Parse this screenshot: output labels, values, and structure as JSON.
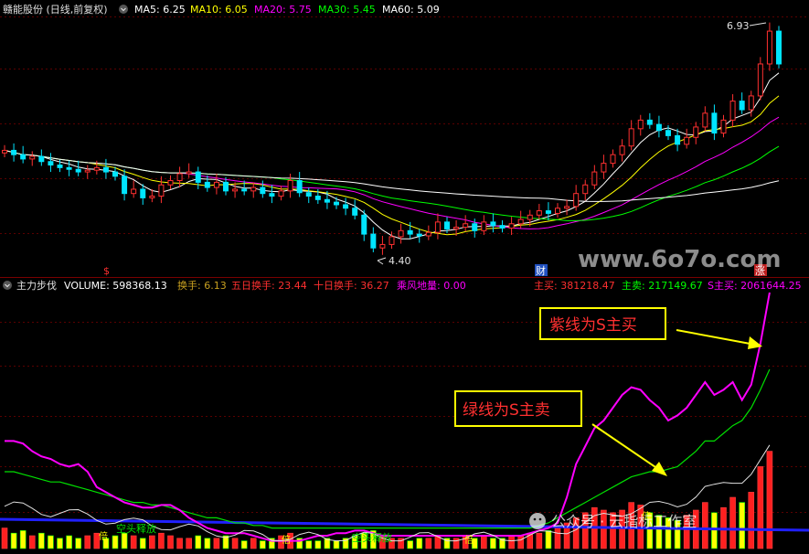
{
  "header": {
    "stock_title": "赣能股份 (日线,前复权)",
    "dropdown_icon": "chevron-down-icon",
    "ma_indicators": [
      {
        "label": "MA5: 6.25",
        "color": "#ffffff"
      },
      {
        "label": "MA10: 6.05",
        "color": "#ffff00"
      },
      {
        "label": "MA20: 5.75",
        "color": "#ff00ff"
      },
      {
        "label": "MA30: 5.45",
        "color": "#00ff00"
      },
      {
        "label": "MA60: 5.09",
        "color": "#ffffff"
      }
    ]
  },
  "price_panel": {
    "high_label": "6.93",
    "low_label": "4.40",
    "event_markers": [
      "$",
      "财",
      "涨"
    ],
    "watermark": "www.6o7o.com"
  },
  "volume_panel": {
    "indicator_name": "主力步伐",
    "stats": [
      {
        "label": "VOLUME: 598368.13",
        "color": "#ffffff"
      },
      {
        "label": "换手: 6.13",
        "color": "#c8a020"
      },
      {
        "label": "五日换手: 23.44",
        "color": "#ff3030"
      },
      {
        "label": "十日换手: 36.27",
        "color": "#ff3030"
      },
      {
        "label": "乘风地量: 0.00",
        "color": "#ff00ff"
      },
      {
        "label": "主买: 381218.47",
        "color": "#ff3030"
      },
      {
        "label": "主卖: 217149.67",
        "color": "#00ff00"
      },
      {
        "label": "S主买: 2061644.25",
        "color": "#ff00ff"
      }
    ],
    "annotations": {
      "purple_note": "紫线为S主买",
      "green_note": "绿线为S主卖"
    },
    "bottom_labels": {
      "release_1": "空头释放",
      "release_2": "空头释放",
      "bei": "倍"
    },
    "wechat_watermark": "公众号 · 云指标工作室"
  },
  "chart_data": [
    {
      "type": "candlestick",
      "title": "赣能股份 (日线,前复权)",
      "series": [
        {
          "name": "MA5",
          "color": "#ffffff",
          "last_value": 6.25
        },
        {
          "name": "MA10",
          "color": "#ffff00",
          "last_value": 6.05
        },
        {
          "name": "MA20",
          "color": "#ff00ff",
          "last_value": 5.75
        },
        {
          "name": "MA30",
          "color": "#00ff00",
          "last_value": 5.45
        },
        {
          "name": "MA60",
          "color": "#ffffff",
          "last_value": 5.09
        }
      ],
      "closes": [
        5.55,
        5.5,
        5.45,
        5.48,
        5.42,
        5.38,
        5.35,
        5.33,
        5.3,
        5.32,
        5.35,
        5.3,
        5.25,
        5.05,
        5.1,
        5.0,
        5.02,
        5.15,
        5.2,
        5.28,
        5.3,
        5.18,
        5.12,
        5.18,
        5.08,
        5.1,
        5.08,
        5.12,
        5.05,
        5.02,
        5.08,
        5.2,
        5.06,
        5.02,
        4.98,
        4.95,
        4.92,
        4.88,
        4.8,
        4.58,
        4.42,
        4.46,
        4.55,
        4.62,
        4.58,
        4.56,
        4.6,
        4.72,
        4.64,
        4.66,
        4.7,
        4.62,
        4.72,
        4.68,
        4.65,
        4.7,
        4.75,
        4.8,
        4.85,
        4.82,
        4.88,
        4.9,
        5.05,
        5.15,
        5.3,
        5.4,
        5.5,
        5.6,
        5.8,
        5.9,
        5.85,
        5.78,
        5.72,
        5.62,
        5.7,
        5.82,
        5.98,
        5.75,
        5.9,
        6.12,
        6.02,
        6.18,
        6.55,
        6.93,
        6.55
      ],
      "high_marker": 6.93,
      "low_marker": 4.4
    },
    {
      "type": "bar+line",
      "name": "主力步伐",
      "stats": {
        "VOLUME": 598368.13,
        "换手": 6.13,
        "五日换手": 23.44,
        "十日换手": 36.27,
        "乘风地量": 0.0,
        "主买": 381218.47,
        "主卖": 217149.67,
        "S主买": 2061644.25
      },
      "s_buy_line": [
        0.42,
        0.42,
        0.41,
        0.38,
        0.36,
        0.35,
        0.33,
        0.32,
        0.33,
        0.3,
        0.24,
        0.22,
        0.2,
        0.18,
        0.17,
        0.16,
        0.16,
        0.17,
        0.17,
        0.15,
        0.12,
        0.1,
        0.08,
        0.07,
        0.06,
        0.06,
        0.06,
        0.05,
        0.04,
        0.03,
        0.03,
        0.03,
        0.03,
        0.04,
        0.05,
        0.05,
        0.06,
        0.06,
        0.07,
        0.07,
        0.06,
        0.05,
        0.05,
        0.05,
        0.05,
        0.05,
        0.05,
        0.05,
        0.05,
        0.05,
        0.05,
        0.05,
        0.05,
        0.05,
        0.05,
        0.05,
        0.05,
        0.06,
        0.07,
        0.08,
        0.1,
        0.2,
        0.33,
        0.4,
        0.47,
        0.5,
        0.55,
        0.6,
        0.63,
        0.62,
        0.58,
        0.55,
        0.5,
        0.52,
        0.55,
        0.6,
        0.65,
        0.6,
        0.62,
        0.65,
        0.58,
        0.64,
        0.8,
        1.0
      ],
      "s_sell_line": [
        0.3,
        0.3,
        0.29,
        0.28,
        0.27,
        0.26,
        0.26,
        0.25,
        0.24,
        0.23,
        0.22,
        0.21,
        0.2,
        0.19,
        0.18,
        0.18,
        0.17,
        0.17,
        0.16,
        0.15,
        0.14,
        0.13,
        0.12,
        0.12,
        0.11,
        0.1,
        0.1,
        0.09,
        0.09,
        0.08,
        0.08,
        0.08,
        0.08,
        0.08,
        0.08,
        0.08,
        0.08,
        0.08,
        0.08,
        0.08,
        0.08,
        0.08,
        0.08,
        0.08,
        0.08,
        0.08,
        0.08,
        0.08,
        0.08,
        0.08,
        0.08,
        0.08,
        0.08,
        0.08,
        0.08,
        0.08,
        0.08,
        0.08,
        0.09,
        0.1,
        0.12,
        0.14,
        0.16,
        0.18,
        0.2,
        0.22,
        0.24,
        0.26,
        0.28,
        0.29,
        0.3,
        0.3,
        0.31,
        0.32,
        0.35,
        0.38,
        0.42,
        0.42,
        0.45,
        0.48,
        0.5,
        0.55,
        0.62,
        0.7
      ],
      "volume_bars": [
        0.08,
        0.06,
        0.07,
        0.05,
        0.06,
        0.05,
        0.04,
        0.05,
        0.04,
        0.05,
        0.06,
        0.04,
        0.05,
        0.06,
        0.05,
        0.04,
        0.05,
        0.06,
        0.05,
        0.04,
        0.04,
        0.05,
        0.04,
        0.04,
        0.05,
        0.04,
        0.03,
        0.04,
        0.03,
        0.04,
        0.05,
        0.06,
        0.04,
        0.03,
        0.03,
        0.04,
        0.03,
        0.04,
        0.05,
        0.06,
        0.07,
        0.05,
        0.04,
        0.04,
        0.03,
        0.04,
        0.04,
        0.05,
        0.04,
        0.04,
        0.05,
        0.04,
        0.05,
        0.04,
        0.04,
        0.05,
        0.05,
        0.06,
        0.06,
        0.07,
        0.08,
        0.1,
        0.12,
        0.14,
        0.16,
        0.15,
        0.14,
        0.15,
        0.18,
        0.17,
        0.14,
        0.13,
        0.12,
        0.11,
        0.13,
        0.15,
        0.18,
        0.14,
        0.16,
        0.2,
        0.18,
        0.22,
        0.32,
        0.38
      ]
    }
  ]
}
